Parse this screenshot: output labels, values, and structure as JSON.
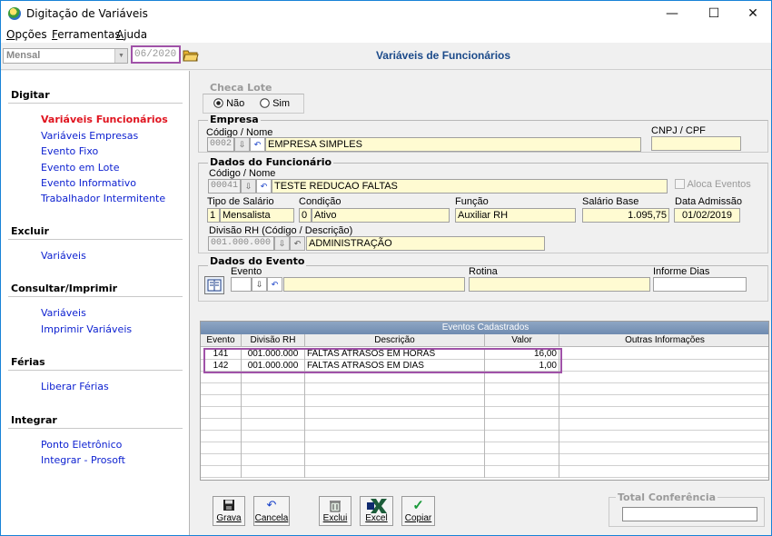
{
  "window": {
    "title": "Digitação de Variáveis",
    "minimize": "—",
    "maximize": "☐",
    "close": "✕"
  },
  "menu": [
    {
      "u": "O",
      "rest": "pções"
    },
    {
      "u": "F",
      "rest": "erramentas"
    },
    {
      "u": "A",
      "rest": "juda"
    }
  ],
  "toolbar": {
    "period": "Mensal",
    "competence": "06/2020",
    "page_title": "Variáveis de Funcionários"
  },
  "sidebar": {
    "digitar": {
      "title": "Digitar",
      "items": [
        "Variáveis Funcionários",
        "Variáveis Empresas",
        "Evento Fixo",
        "Evento em Lote",
        "Evento Informativo",
        "Trabalhador Intermitente"
      ]
    },
    "excluir": {
      "title": "Excluir",
      "items": [
        "Variáveis"
      ]
    },
    "consultar": {
      "title": "Consultar/Imprimir",
      "items": [
        "Variáveis",
        "Imprimir Variáveis"
      ]
    },
    "ferias": {
      "title": "Férias",
      "items": [
        "Liberar Férias"
      ]
    },
    "integrar": {
      "title": "Integrar",
      "items": [
        "Ponto Eletrônico",
        "Integrar - Prosoft"
      ]
    }
  },
  "checa_lote": {
    "title": "Checa Lote",
    "nao": "Não",
    "sim": "Sim",
    "selected": "Não"
  },
  "empresa": {
    "title": "Empresa",
    "code_label": "Código / Nome",
    "code": "0002",
    "name": "EMPRESA SIMPLES",
    "cnpj_label": "CNPJ / CPF",
    "cnpj": ""
  },
  "funcionario": {
    "title": "Dados do Funcionário",
    "code_label": "Código / Nome",
    "code": "00041",
    "name": "TESTE REDUCAO FALTAS",
    "aloca_label": "Aloca Eventos",
    "tipo_label": "Tipo de Salário",
    "tipo_code": "1",
    "tipo_desc": "Mensalista",
    "cond_label": "Condição",
    "cond_code": "0",
    "cond_desc": "Ativo",
    "funcao_label": "Função",
    "funcao": "Auxiliar RH",
    "salario_label": "Salário Base",
    "salario": "1.095,75",
    "admissao_label": "Data Admissão",
    "admissao": "01/02/2019",
    "divisao_label": "Divisão RH (Código / Descrição)",
    "divisao_code": "001.000.000",
    "divisao_desc": "ADMINISTRAÇÃO"
  },
  "evento": {
    "title": "Dados do Evento",
    "evento_label": "Evento",
    "rotina_label": "Rotina",
    "dias_label": "Informe Dias"
  },
  "grid": {
    "caption": "Eventos Cadastrados",
    "columns": [
      "Evento",
      "Divisão RH",
      "Descrição",
      "Valor",
      "Outras Informações"
    ],
    "rows": [
      [
        "141",
        "001.000.000",
        "FALTAS ATRASOS EM HORAS",
        "16,00",
        ""
      ],
      [
        "142",
        "001.000.000",
        "FALTAS ATRASOS EM DIAS",
        "1,00",
        ""
      ]
    ]
  },
  "buttons": {
    "grava": "Grava",
    "cancela": "Cancela",
    "exclui": "Exclui",
    "excel": "Excel",
    "copiar": "Copiar"
  },
  "total": {
    "title": "Total Conferência",
    "value": ""
  }
}
